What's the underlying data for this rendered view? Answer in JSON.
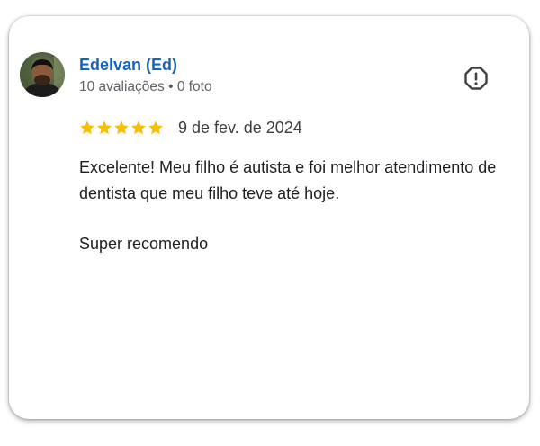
{
  "review": {
    "author": {
      "name": "Edelvan (Ed)",
      "meta": "10 avaliações • 0 foto",
      "avatar_icon": "user-avatar-photo"
    },
    "rating": 5,
    "max_rating": 5,
    "date": "9 de fev. de 2024",
    "paragraphs": [
      "Excelente! Meu filho é autista e foi melhor atendimento de dentista que meu filho teve até hoje.",
      "Super recomendo"
    ],
    "report_icon": "report-icon"
  },
  "colors": {
    "author_name": "#1565c0",
    "star": "#fbbc04",
    "meta_text": "#5f6368",
    "body_text": "#202124",
    "icon": "#3c4043"
  }
}
